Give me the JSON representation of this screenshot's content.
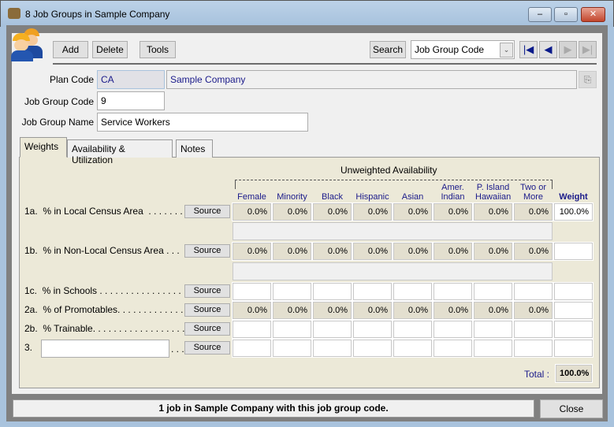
{
  "window": {
    "title": "8 Job Groups in Sample Company",
    "minimize": "‒",
    "maximize": "▫",
    "close": "✕"
  },
  "toolbar": {
    "add": "Add",
    "delete": "Delete",
    "tools": "Tools",
    "search": "Search",
    "search_field": "Job Group Code"
  },
  "form": {
    "plan_code_label": "Plan Code",
    "plan_code": "CA",
    "company": "Sample Company",
    "job_group_code_label": "Job Group Code",
    "job_group_code": "9",
    "job_group_name_label": "Job Group Name",
    "job_group_name": "Service Workers"
  },
  "tabs": [
    "Weights",
    "Availability & Utilization",
    "Notes"
  ],
  "grid": {
    "group_header": "Unweighted Availability",
    "columns": [
      "Female",
      "Minority",
      "Black",
      "Hispanic",
      "Asian",
      "Amer. Indian",
      "P. Island Hawaiian",
      "Two or More"
    ],
    "weight_header": "Weight",
    "source_label": "Source",
    "rows": [
      {
        "label": "1a.  % in Local Census Area  . . . . . . .",
        "values": [
          "0.0%",
          "0.0%",
          "0.0%",
          "0.0%",
          "0.0%",
          "0.0%",
          "0.0%",
          "0.0%"
        ],
        "weight": "100.0%"
      },
      {
        "label": "1b.  % in Non-Local Census Area . . .",
        "values": [
          "0.0%",
          "0.0%",
          "0.0%",
          "0.0%",
          "0.0%",
          "0.0%",
          "0.0%",
          "0.0%"
        ],
        "weight": ""
      },
      {
        "label": "1c.  % in Schools . . . . . . . . . . . . . . . . .",
        "values": null,
        "weight": ""
      },
      {
        "label": "2a.  % of Promotables. . . . . . . . . . . . .",
        "values": [
          "0.0%",
          "0.0%",
          "0.0%",
          "0.0%",
          "0.0%",
          "0.0%",
          "0.0%",
          "0.0%"
        ],
        "weight": ""
      },
      {
        "label": "2b.  % Trainable. . . . . . . . . . . . . . . . . .",
        "values": null,
        "weight": ""
      },
      {
        "label": "3.",
        "values": null,
        "weight": ""
      }
    ],
    "total_label": "Total :",
    "total": "100.0%"
  },
  "status": {
    "message": "1 job in Sample Company with this job group code.",
    "close": "Close"
  }
}
